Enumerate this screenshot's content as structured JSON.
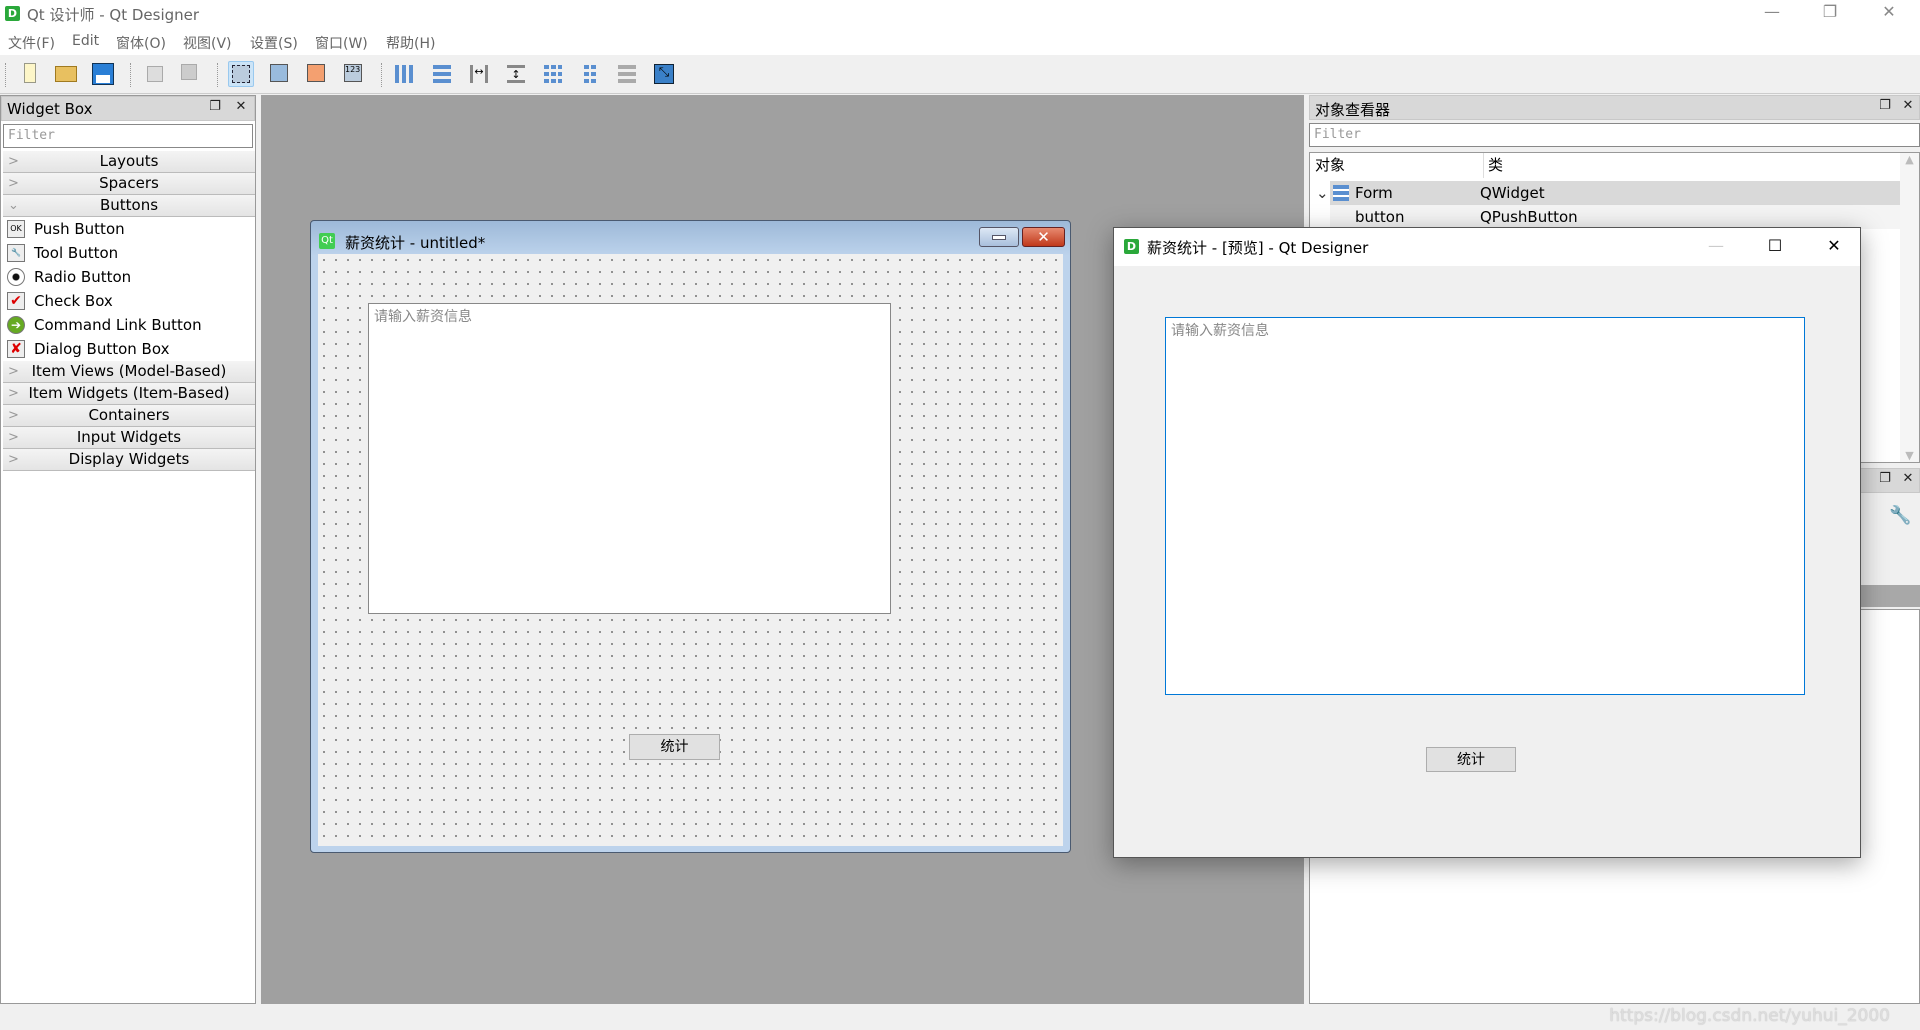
{
  "app": {
    "title": "Qt 设计师 - Qt Designer",
    "logo_letter": "D"
  },
  "menu": [
    "文件(F)",
    "Edit",
    "窗体(O)",
    "视图(V)",
    "设置(S)",
    "窗口(W)",
    "帮助(H)"
  ],
  "toolbar": [
    "new-icon",
    "open-icon",
    "save-icon",
    "send-to-back-icon",
    "bring-to-front-icon",
    "edit-widgets-icon",
    "edit-signals-slots-icon",
    "edit-buddies-icon",
    "edit-tab-order-icon",
    "layout-horizontal-icon",
    "layout-vertical-icon",
    "layout-h-splitter-icon",
    "layout-v-splitter-icon",
    "layout-grid-icon",
    "layout-form-icon",
    "break-layout-icon",
    "adjust-size-icon"
  ],
  "widget_box": {
    "title": "Widget Box",
    "filter_placeholder": "Filter",
    "categories_top": [
      "Layouts",
      "Spacers",
      "Buttons"
    ],
    "buttons": [
      "Push Button",
      "Tool Button",
      "Radio Button",
      "Check Box",
      "Command Link Button",
      "Dialog Button Box"
    ],
    "categories_bottom": [
      "Item Views (Model-Based)",
      "Item Widgets (Item-Based)",
      "Containers",
      "Input Widgets",
      "Display Widgets"
    ]
  },
  "form_window": {
    "title": "薪资统计 - untitled*",
    "icon_text": "Qt",
    "textedit_placeholder": "请输入薪资信息",
    "button_label": "统计"
  },
  "object_inspector": {
    "title": "对象查看器",
    "filter_placeholder": "Filter",
    "col_object": "对象",
    "col_class": "类",
    "rows": [
      {
        "object": "Form",
        "class": "QWidget"
      },
      {
        "object": "button",
        "class": "QPushButton"
      }
    ]
  },
  "preview_window": {
    "title": "薪资统计 - [预览] - Qt Designer",
    "textedit_placeholder": "请输入薪资信息",
    "button_label": "统计"
  },
  "watermark": "https://blog.csdn.net/yuhui_2000",
  "colors": {
    "accent": "#0078d7",
    "canvas": "#a0a0a0",
    "logo": "#2aa83a"
  }
}
